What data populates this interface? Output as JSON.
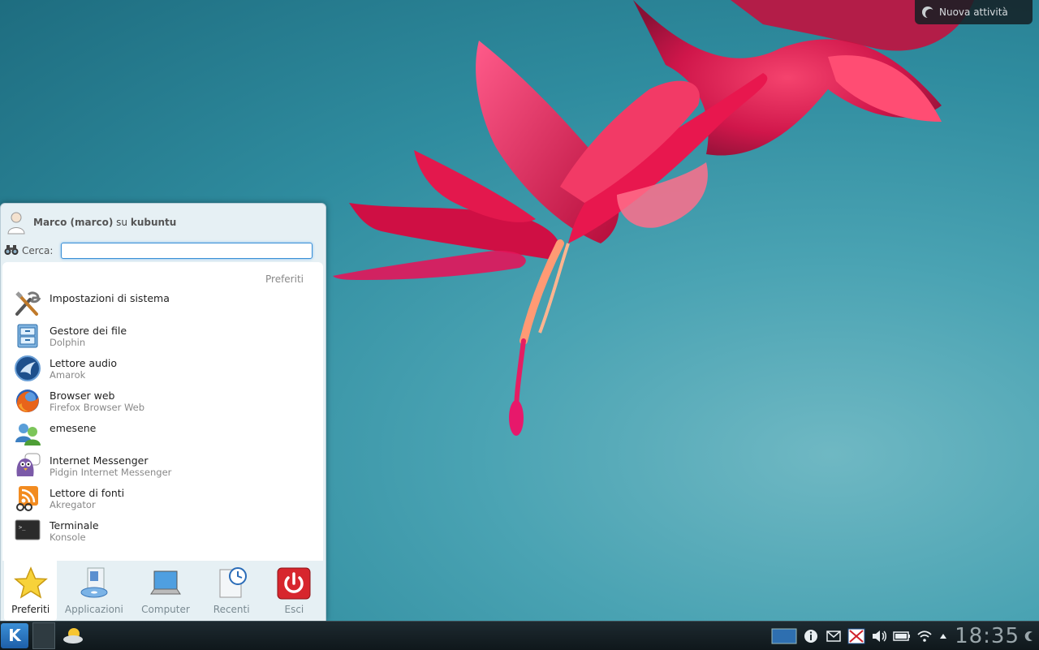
{
  "activity": {
    "label": "Nuova attività"
  },
  "launcher": {
    "user_name": "Marco (marco)",
    "user_on": "su",
    "host": "kubuntu",
    "search_label": "Cerca:",
    "search_value": "",
    "section_title": "Preferiti",
    "favorites": [
      {
        "name": "Impostazioni di sistema",
        "sub": "",
        "icon": "system-settings-icon"
      },
      {
        "name": "Gestore dei file",
        "sub": "Dolphin",
        "icon": "file-manager-icon"
      },
      {
        "name": "Lettore audio",
        "sub": "Amarok",
        "icon": "amarok-icon"
      },
      {
        "name": "Browser web",
        "sub": "Firefox Browser Web",
        "icon": "firefox-icon"
      },
      {
        "name": "emesene",
        "sub": "",
        "icon": "emesene-icon"
      },
      {
        "name": "Internet Messenger",
        "sub": "Pidgin Internet Messenger",
        "icon": "pidgin-icon"
      },
      {
        "name": "Lettore di fonti",
        "sub": "Akregator",
        "icon": "rss-icon"
      },
      {
        "name": "Terminale",
        "sub": "Konsole",
        "icon": "terminal-icon"
      }
    ],
    "tabs": [
      {
        "label": "Preferiti",
        "active": true
      },
      {
        "label": "Applicazioni",
        "active": false
      },
      {
        "label": "Computer",
        "active": false
      },
      {
        "label": "Recenti",
        "active": false
      },
      {
        "label": "Esci",
        "active": false
      }
    ]
  },
  "taskbar": {
    "clock": "18:35",
    "kicker_glyph": "K"
  }
}
